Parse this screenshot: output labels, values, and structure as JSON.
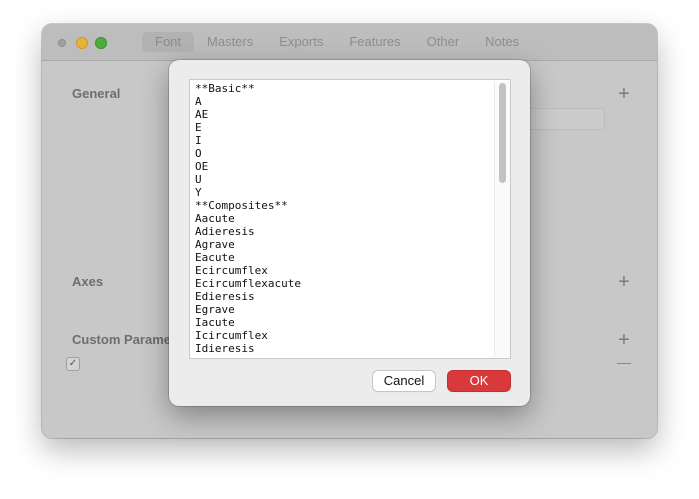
{
  "window": {
    "tabs": [
      "Font",
      "Masters",
      "Exports",
      "Features",
      "Other",
      "Notes"
    ],
    "active_tab": "Font",
    "sections": {
      "general": "General",
      "axes": "Axes",
      "custom_parameters": "Custom Parame"
    },
    "plus_glyph": "+",
    "checkbox_glyph": "✓"
  },
  "dialog": {
    "lines": [
      "**Basic**",
      "A",
      "AE",
      "E",
      "I",
      "O",
      "OE",
      "U",
      "Y",
      "**Composites**",
      "Aacute",
      "Adieresis",
      "Agrave",
      "Eacute",
      "Ecircumflex",
      "Ecircumflexacute",
      "Edieresis",
      "Egrave",
      "Iacute",
      "Icircumflex",
      "Idieresis"
    ],
    "cancel_label": "Cancel",
    "ok_label": "OK"
  },
  "colors": {
    "ok_button": "#d9393b",
    "traffic_min": "#e7b33a",
    "traffic_max": "#4fab3c"
  }
}
